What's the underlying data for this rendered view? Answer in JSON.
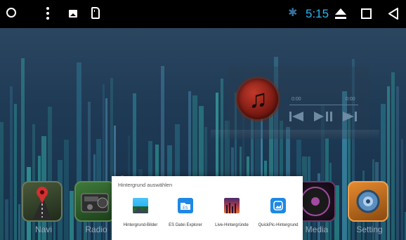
{
  "status_bar": {
    "time": "5:15",
    "icons": [
      "circle-icon",
      "overflow-menu-icon",
      "image-notification-icon",
      "sd-card-icon",
      "bluetooth-icon",
      "eject-icon",
      "recent-apps-icon",
      "back-icon"
    ],
    "time_color": "#29b6f6"
  },
  "music_widget": {
    "elapsed": "0:00",
    "duration": "0:00",
    "controls": [
      "previous-icon",
      "play-pause-icon",
      "next-icon"
    ]
  },
  "dock": {
    "items": [
      {
        "label": "Navi",
        "icon": "navigation-icon"
      },
      {
        "label": "Radio",
        "icon": "radio-icon"
      },
      {
        "label": "Media",
        "icon": "media-disc-icon"
      },
      {
        "label": "Setting",
        "icon": "settings-gear-icon"
      }
    ]
  },
  "dialog": {
    "title": "Hintergrund auswählen",
    "options": [
      {
        "label": "Hintergrund-Bilder",
        "icon": "gallery-icon"
      },
      {
        "label": "ES Datei Explorer",
        "icon": "es-file-explorer-icon"
      },
      {
        "label": "Live-Hintergründe",
        "icon": "live-wallpaper-icon"
      },
      {
        "label": "QuickPic-Hintergrund",
        "icon": "quickpic-icon"
      }
    ]
  },
  "colors": {
    "accent": "#29b6f6",
    "wallpaper_bars": "#2fb0a8",
    "dialog_bg": "#ffffff"
  }
}
